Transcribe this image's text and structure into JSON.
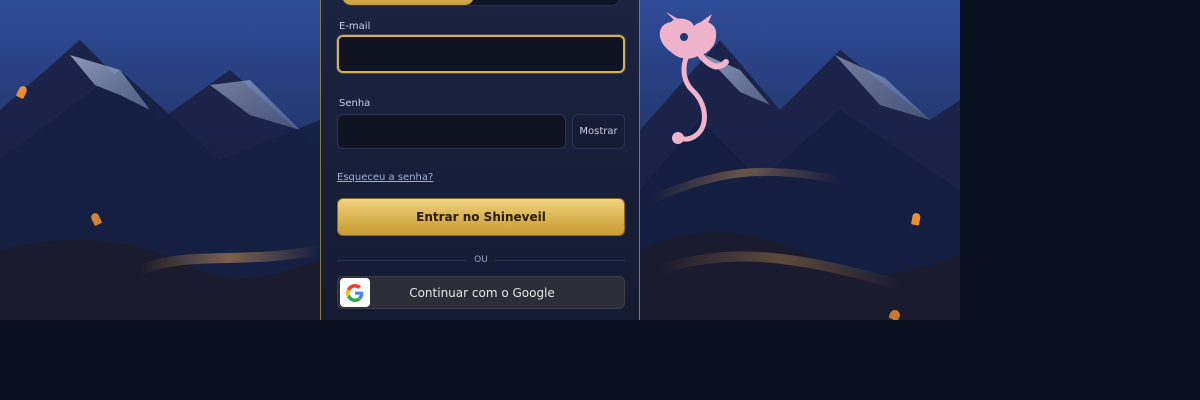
{
  "login": {
    "email_label": "E-mail",
    "email_value": "",
    "password_label": "Senha",
    "password_value": "",
    "show_password_label": "Mostrar",
    "forgot_password_label": "Esqueceu a senha?",
    "submit_label": "Entrar no Shineveil",
    "divider_label": "OU",
    "google_label": "Continuar com o Google"
  },
  "colors": {
    "accent_gold": "#d8b24f",
    "panel_bg": "#1b2341",
    "page_bg": "#0b1020"
  },
  "icons": {
    "google": "google-icon",
    "creature": "mew-creature-icon"
  }
}
